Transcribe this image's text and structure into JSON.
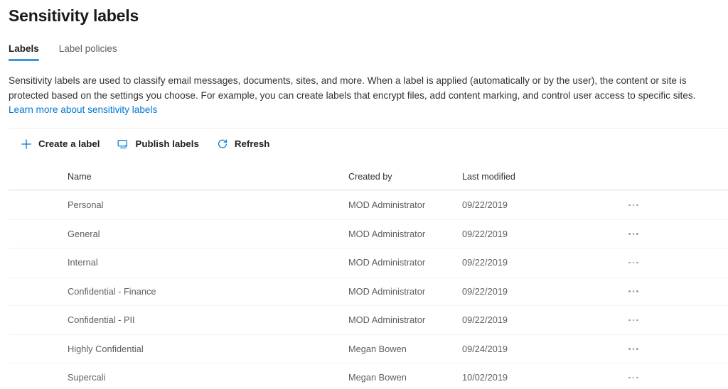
{
  "page": {
    "title": "Sensitivity labels"
  },
  "tabs": [
    {
      "label": "Labels",
      "active": true
    },
    {
      "label": "Label policies",
      "active": false
    }
  ],
  "description": {
    "text_before_link": "Sensitivity labels are used to classify email messages, documents, sites, and more. When a label is applied (automatically or by the user), the content or site is protected based on the settings you choose. For example, you can create labels that encrypt files, add content marking, and control user access to specific sites. ",
    "link_text": "Learn more about sensitivity labels"
  },
  "toolbar": {
    "commands": [
      {
        "label": "Create a label",
        "icon": "plus-icon"
      },
      {
        "label": "Publish labels",
        "icon": "publish-monitor-icon"
      },
      {
        "label": "Refresh",
        "icon": "refresh-icon"
      }
    ]
  },
  "table": {
    "columns": [
      "Name",
      "Created by",
      "Last modified"
    ],
    "row_menu_icon": "ellipsis-icon",
    "rows": [
      {
        "name": "Personal",
        "created_by": "MOD Administrator",
        "last_modified": "09/22/2019"
      },
      {
        "name": "General",
        "created_by": "MOD Administrator",
        "last_modified": "09/22/2019"
      },
      {
        "name": "Internal",
        "created_by": "MOD Administrator",
        "last_modified": "09/22/2019"
      },
      {
        "name": "Confidential - Finance",
        "created_by": "MOD Administrator",
        "last_modified": "09/22/2019"
      },
      {
        "name": "Confidential - PII",
        "created_by": "MOD Administrator",
        "last_modified": "09/22/2019"
      },
      {
        "name": "Highly Confidential",
        "created_by": "Megan Bowen",
        "last_modified": "09/24/2019"
      },
      {
        "name": "Supercali",
        "created_by": "Megan Bowen",
        "last_modified": "10/02/2019"
      }
    ]
  },
  "colors": {
    "accent": "#0078d4",
    "tab_underline": "#3a96dd",
    "title_text": "#1b1a19",
    "body_text": "#323130",
    "secondary_text": "#605e5c",
    "divider": "#edebe9"
  }
}
